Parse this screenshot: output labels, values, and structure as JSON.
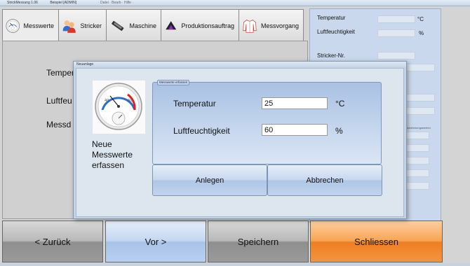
{
  "window": {
    "title": "StrickMessung 1.06",
    "subtitle": "Beispiel [ADMIN]",
    "menu_hint": "· Datei · Bearb · Hilfe ·"
  },
  "tabs": [
    {
      "label": "Messwerte",
      "icon": "thermometer-icon",
      "active": true
    },
    {
      "label": "Stricker",
      "icon": "users-icon",
      "active": false
    },
    {
      "label": "Maschine",
      "icon": "machine-icon",
      "active": false
    },
    {
      "label": "Produktionsauftrag",
      "icon": "fabric-icon",
      "active": false
    },
    {
      "label": "Messvorgang",
      "icon": "sweater-icon",
      "active": false
    }
  ],
  "content": {
    "label_temperatur": "Temper",
    "label_luftfeucht": "Luftfeu",
    "label_messdatum": "Messd"
  },
  "right_panel": {
    "temperatur_label": "Temperatur",
    "temperatur_unit": "°C",
    "luftfeuchtigkeit_label": "Luftfeuchtigkeit",
    "luftfeuchtigkeit_unit": "%",
    "stricker_label": "Stricker-Nr.",
    "small_label": "Abweichungswerten"
  },
  "bottom_buttons": {
    "back": "< Zurück",
    "next": "Vor >",
    "save": "Speichern",
    "close": "Schliessen"
  },
  "dialog": {
    "title": "Neuanlage",
    "caption": "Neue Messwerte erfassen",
    "group_title": "Messwerte erfassen",
    "temperatur_label": "Temperatur",
    "temperatur_value": "25",
    "temperatur_unit": "°C",
    "luft_label": "Luftfeuchtigkeit",
    "luft_value": "60",
    "luft_unit": "%",
    "create_button": "Anlegen",
    "cancel_button": "Abbrechen"
  }
}
